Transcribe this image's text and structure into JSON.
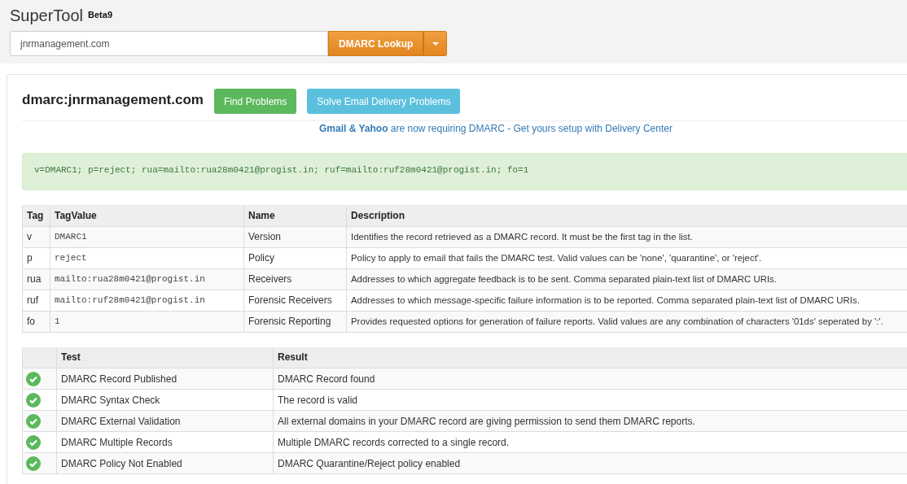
{
  "app": {
    "title": "SuperTool",
    "badge": "Beta9"
  },
  "search": {
    "value": "jnrmanagement.com",
    "button": "DMARC Lookup"
  },
  "result": {
    "heading": "dmarc:jnrmanagement.com",
    "buttons": [
      {
        "label": "Find Problems",
        "kind": "success"
      },
      {
        "label": "Solve Email Delivery Problems",
        "kind": "info"
      }
    ],
    "notice": "**Gmail & Yahoo** are now requiring DMARC - Get yours setup with Delivery Center",
    "record": "v=DMARC1; p=reject; rua=mailto:rua28m0421@progist.in; ruf=mailto:ruf28m0421@progist.in; fo=1"
  },
  "tags_table": {
    "columns": [
      "Tag",
      "TagValue",
      "Name",
      "Description"
    ],
    "rows": [
      {
        "tag": "v",
        "value": "DMARC1",
        "name": "Version",
        "description": "Identifies the record retrieved as a DMARC record. It must be the first tag in the list."
      },
      {
        "tag": "p",
        "value": "reject",
        "name": "Policy",
        "description": "Policy to apply to email that fails the DMARC test. Valid values can be 'none', 'quarantine', or 'reject'."
      },
      {
        "tag": "rua",
        "value": "mailto:rua28m0421@progist.in",
        "name": "Receivers",
        "description": "Addresses to which aggregate feedback is to be sent. Comma separated plain-text list of DMARC URIs."
      },
      {
        "tag": "ruf",
        "value": "mailto:ruf28m0421@progist.in",
        "name": "Forensic Receivers",
        "description": "Addresses to which message-specific failure information is to be reported. Comma separated plain-text list of DMARC URIs."
      },
      {
        "tag": "fo",
        "value": "1",
        "name": "Forensic Reporting",
        "description": "Provides requested options for generation of failure reports. Valid values are any combination of characters '01ds' seperated by ':'."
      }
    ]
  },
  "tests_table": {
    "columns": [
      "Test",
      "Result"
    ],
    "rows": [
      {
        "passed": true,
        "test": "DMARC Record Published",
        "result": "DMARC Record found"
      },
      {
        "passed": true,
        "test": "DMARC Syntax Check",
        "result": "The record is valid"
      },
      {
        "passed": true,
        "test": "DMARC External Validation",
        "result": "All external domains in your DMARC record are giving permission to send them DMARC reports."
      },
      {
        "passed": true,
        "test": "DMARC Multiple Records",
        "result": "Multiple DMARC records corrected to a single record."
      },
      {
        "passed": true,
        "test": "DMARC Policy Not Enabled",
        "result": "DMARC Quarantine/Reject policy enabled"
      }
    ]
  }
}
